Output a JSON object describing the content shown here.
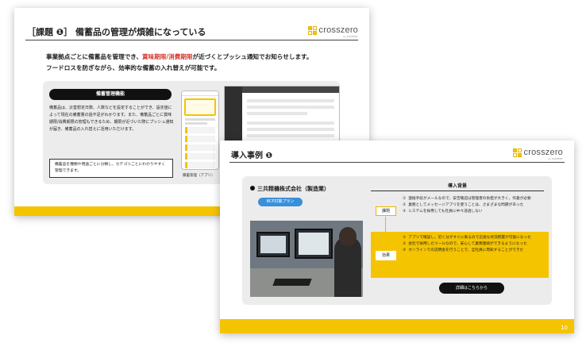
{
  "brand": {
    "logo_text": "crosszero",
    "logo_sub": "by ELEMENT"
  },
  "slide1": {
    "title": "［課題 ❶］ 備蓄品の管理が煩雑になっている",
    "intro_before": "事業拠点ごとに備蓄品を管理でき、",
    "intro_highlight": "賞味期限/消費期限",
    "intro_after": "が近づくとプッシュ通知でお知らせします。",
    "intro_line2": "フードロスを防ぎながら、効率的な備蓄の入れ替えが可能です。",
    "feature_heading": "備蓄管理機能",
    "feature_desc": "備蓄品は、災害想定日数、人数などを設定することができ、設定値によって現在の備蓄量の過不足がわかります。また、備蓄品ごとに賞味期限/消費期限の管理もできるため、期限が近づいた際にプッシュ通知が届き、備蓄品の入れ替えに活用いただけます。",
    "note": "備蓄品を種類や用途ごとに分類し、カテゴリごとにわかりやすく管理できます。",
    "phone_caption": "備蓄管理（アプリ）",
    "accent_color": "#f5c400",
    "highlight_color": "#d9352b"
  },
  "slide2": {
    "title": "導入事例 ❶",
    "company": "三共精機株式会社（製造業）",
    "plan": "BCP対策プラン",
    "background_heading": "導入背景",
    "issue_label": "課題",
    "issues": [
      {
        "num": "①",
        "text": "連絡手段がメールなので、安否確認は管理者の負担が大きく、作業が必要"
      },
      {
        "num": "②",
        "text": "業務としてメッセージアプリを使うことは、さまざまな問題があった"
      },
      {
        "num": "③",
        "text": "システムを採用しても社員に中々浸透しない"
      }
    ],
    "effect_label": "効果",
    "effects": [
      {
        "num": "①",
        "text": "アプリで確認し、近く分がすぐに来るので迅速な状況把握が可能になった"
      },
      {
        "num": "②",
        "text": "会社で採用したツールなので、安心して業務連絡ができるようになった"
      },
      {
        "num": "③",
        "text": "オンラインでの説明会を行うことで、全社員に周知することができた"
      }
    ],
    "detail_button": "詳細はこちらから",
    "page_number": "10"
  }
}
